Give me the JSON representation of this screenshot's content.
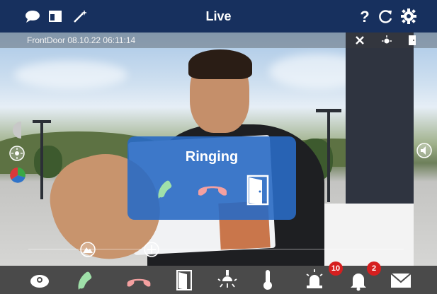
{
  "header": {
    "title": "Live",
    "left_icons": [
      "chat-icon",
      "window-icon",
      "magic-wand-icon"
    ],
    "right_icons": [
      "help-icon",
      "refresh-icon",
      "settings-icon"
    ]
  },
  "camera": {
    "label": "FrontDoor 08.10.22 06:11:14",
    "overlay_icons": [
      "tools-icon",
      "light-icon",
      "door-icon"
    ]
  },
  "ringing_dialog": {
    "label": "Ringing",
    "actions": [
      "accept-call-icon",
      "reject-call-icon",
      "open-door-icon"
    ]
  },
  "bottom_bar": {
    "items": [
      {
        "icon": "camera-dome-icon"
      },
      {
        "icon": "accept-call-icon"
      },
      {
        "icon": "hang-up-icon"
      },
      {
        "icon": "door-open-icon"
      },
      {
        "icon": "light-icon"
      },
      {
        "icon": "thermometer-icon"
      },
      {
        "icon": "alarm-light-icon",
        "badge": "10"
      },
      {
        "icon": "bell-icon",
        "badge": "2"
      },
      {
        "icon": "mail-icon"
      }
    ]
  },
  "colors": {
    "header_bg": "#17305e",
    "dialog_bg": "#296ac4",
    "accept": "#9fe0a9",
    "reject": "#f4a0a0",
    "badge": "#d61f1f"
  }
}
